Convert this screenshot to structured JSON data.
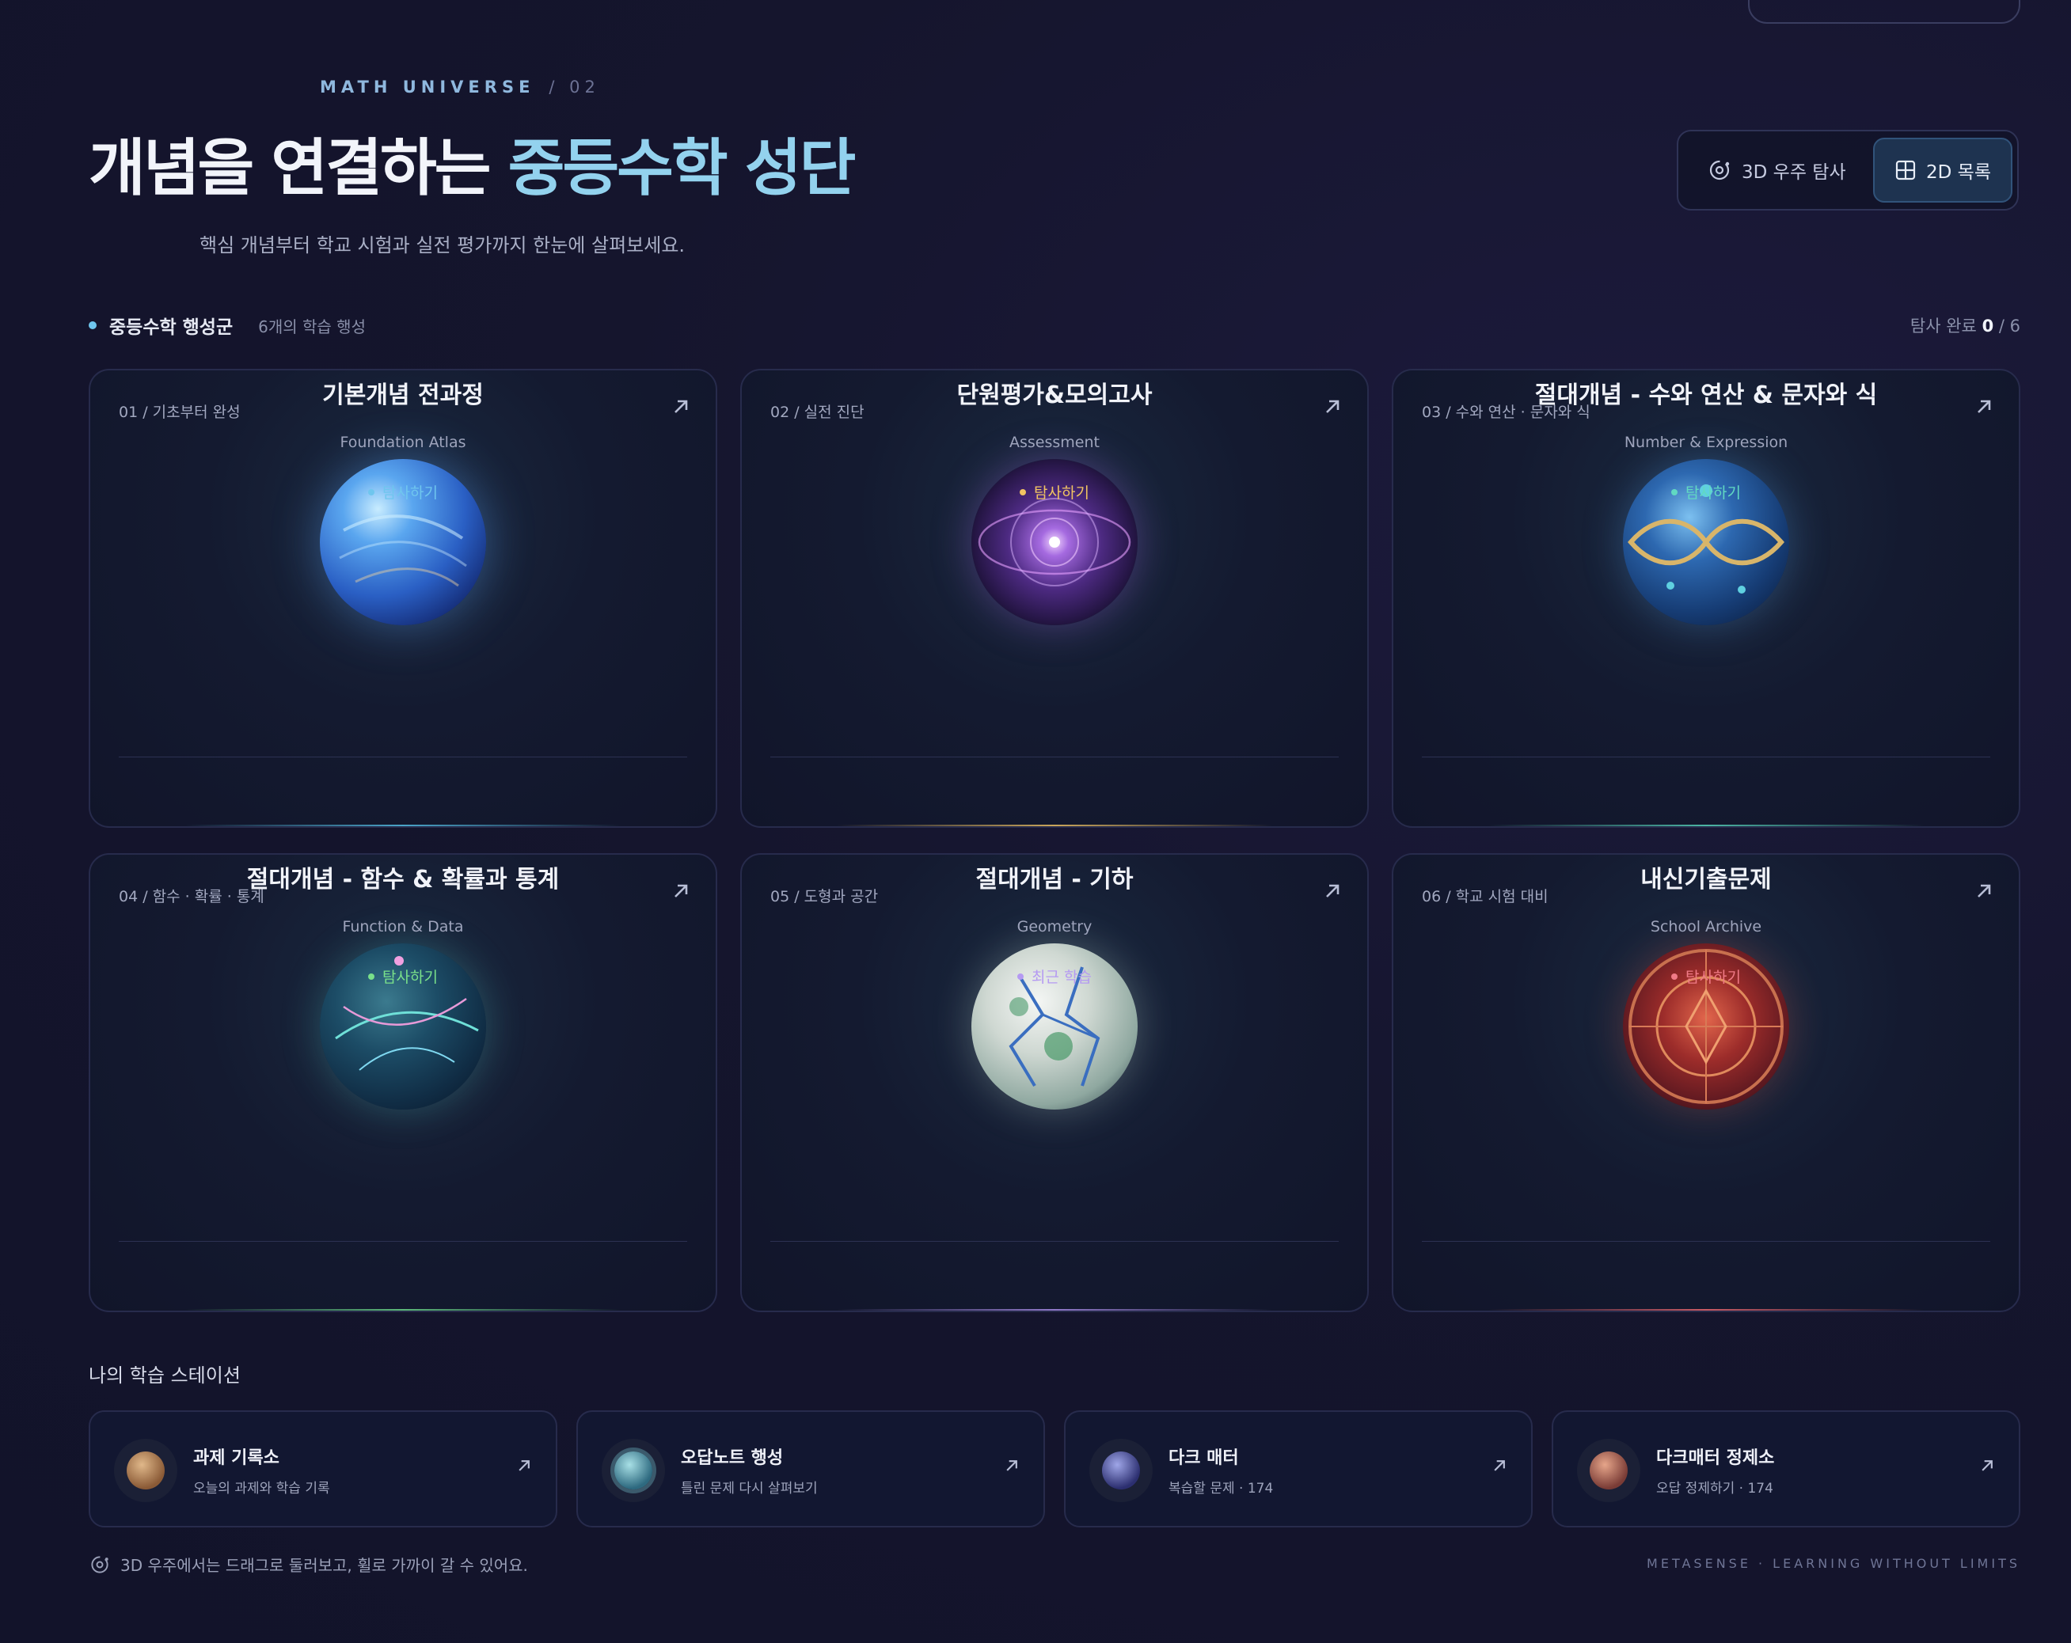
{
  "header": {
    "eyebrow": "MATH UNIVERSE",
    "eyebrow_num": "/ 02",
    "title_main": "개념을 연결하는 ",
    "title_accent": "중등수학 성단",
    "subtitle": "핵심 개념부터 학교 시험과 실전 평가까지 한눈에 살펴보세요."
  },
  "view_toggle": {
    "view_3d": "3D 우주 탐사",
    "view_2d": "2D 목록",
    "selected": "2D 목록"
  },
  "section": {
    "label": "중등수학 행성군",
    "count": "6개의 학습 행성",
    "progress_label": "탐사 완료",
    "progress_done": "0",
    "progress_total": "/ 6"
  },
  "cards": [
    {
      "tag": "01 / 기초부터 완성",
      "name": "기본개념 전과정",
      "en": "Foundation Atlas",
      "status": "탐사하기",
      "status_color": "#6fc6ee"
    },
    {
      "tag": "02 / 실전 진단",
      "name": "단원평가&모의고사",
      "en": "Assessment",
      "status": "탐사하기",
      "status_color": "#f1c462"
    },
    {
      "tag": "03 / 수와 연산 · 문자와 식",
      "name": "절대개념 - 수와 연산 & 문자와 식",
      "en": "Number & Expression",
      "status": "탐사하기",
      "status_color": "#61d9c2"
    },
    {
      "tag": "04 / 함수 · 확률 · 통계",
      "name": "절대개념 - 함수 & 확률과 통계",
      "en": "Function & Data",
      "status": "탐사하기",
      "status_color": "#79e08a"
    },
    {
      "tag": "05 / 도형과 공간",
      "name": "절대개념 - 기하",
      "en": "Geometry",
      "status": "최근 학습",
      "status_color": "#b59af2"
    },
    {
      "tag": "06 / 학교 시험 대비",
      "name": "내신기출문제",
      "en": "School Archive",
      "status": "탐사하기",
      "status_color": "#f07a86"
    }
  ],
  "stations": {
    "title": "나의 학습 스테이션",
    "items": [
      {
        "title": "과제 기록소",
        "sub": "오늘의 과제와 학습 기록"
      },
      {
        "title": "오답노트 행성",
        "sub": "틀린 문제 다시 살펴보기"
      },
      {
        "title": "다크 매터",
        "sub": "복습할 문제 · 174"
      },
      {
        "title": "다크매터 정제소",
        "sub": "오답 정제하기 · 174"
      }
    ]
  },
  "footer": {
    "hint": "3D 우주에서는 드래그로 둘러보고, 휠로 가까이 갈 수 있어요.",
    "brand": "METASENSE · LEARNING WITHOUT LIMITS"
  }
}
